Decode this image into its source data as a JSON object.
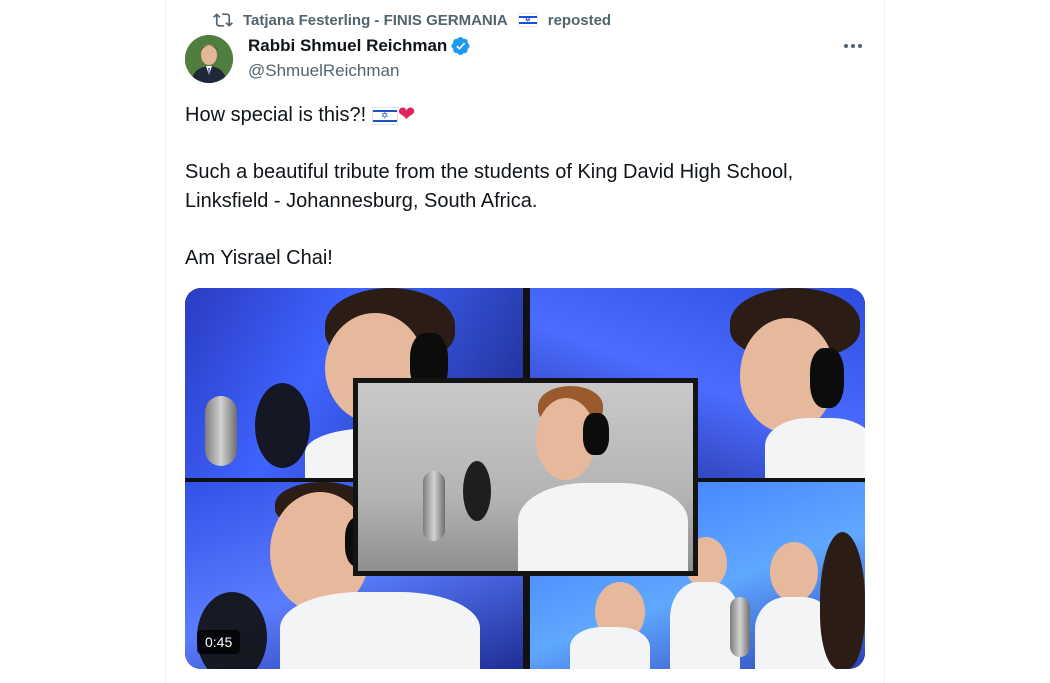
{
  "repost": {
    "reposter": "Tatjana Festerling - FINIS GERMANIA",
    "flag_icon": "israel-flag-icon",
    "suffix": "reposted"
  },
  "author": {
    "display_name": "Rabbi Shmuel Reichman",
    "handle": "@ShmuelReichman",
    "verified": true,
    "verified_color": "#1d9bf0"
  },
  "tweet": {
    "line1": "How special is this?!",
    "line2": "Such a beautiful tribute from the students of King David High School,",
    "line3": "Linksfield - Johannesburg, South Africa.",
    "line4": "Am Yisrael Chai!",
    "heart": "❤"
  },
  "media": {
    "duration": "0:45"
  },
  "colors": {
    "text_primary": "#0f1419",
    "text_secondary": "#536471",
    "border": "#eff3f4",
    "heart": "#e0245e"
  }
}
